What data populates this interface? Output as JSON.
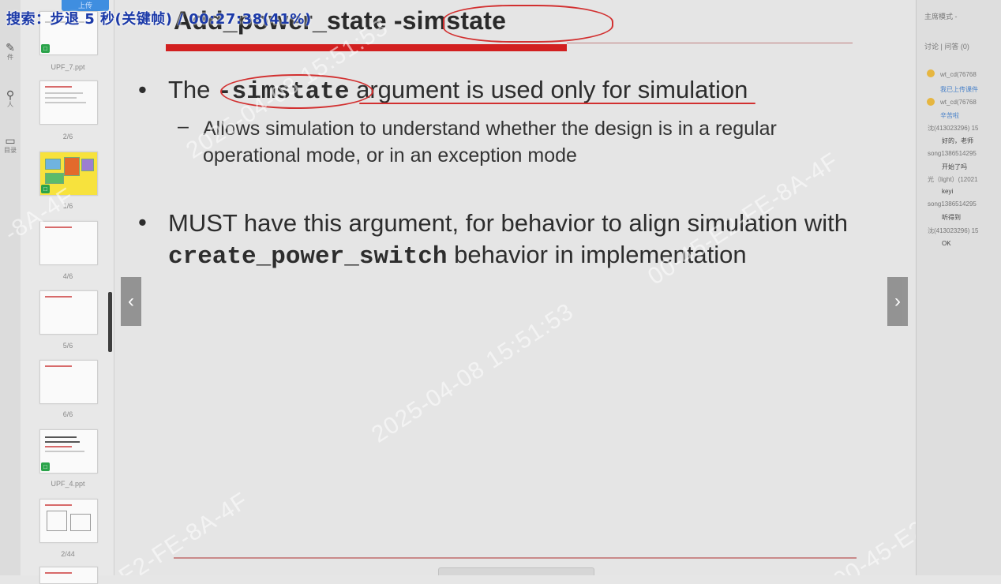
{
  "overlay": {
    "seek_text": "搜索：步退 5 秒(关键帧) / 00:27:38(41%)"
  },
  "toolstrip": {
    "items": [
      {
        "icon": "pencil-icon",
        "label": "件"
      },
      {
        "icon": "pin-icon",
        "label": "人"
      },
      {
        "icon": "doc-icon",
        "label": "目录"
      }
    ]
  },
  "thumbnails": {
    "upload_button": "上传",
    "labels": [
      "UPF_7.ppt",
      "2/6",
      "1/6",
      "4/6",
      "5/6",
      "6/6",
      "UPF_4.ppt",
      "2/44"
    ],
    "badge_symbol": "□"
  },
  "slide": {
    "title_main": "Add_power_state ",
    "title_flag": "-simstate",
    "bullet_glyph": "•",
    "sub_glyph": "–",
    "bullet1_pre": "The ",
    "bullet1_code": "-simstate",
    "bullet1_post": " argument is used only for simulation",
    "sub1": "Allows simulation to understand whether the design is in a regular operational mode, or in an exception mode",
    "bullet2_pre": "MUST have this argument, for behavior to align simulation with ",
    "bullet2_code": "create_power_switch",
    "bullet2_post": " behavior in implementation"
  },
  "nav": {
    "prev": "‹",
    "next": "›"
  },
  "watermarks": [
    "2025-04-08 15:51:53",
    "2025-04-08 15:51:53",
    "00-45-E2-FE-8A-4F",
    "00-45-E2-FE-8A-4F",
    "E2-FE-8A-4F",
    "-8A-4F"
  ],
  "right_panel": {
    "title": "主席模式 -",
    "tabs": "讨论 | 问答 (0)",
    "lines": [
      {
        "kind": "user",
        "text": "wt_cd(76768"
      },
      {
        "kind": "link",
        "text": "我已上传课件"
      },
      {
        "kind": "user",
        "text": "wt_cd(76768"
      },
      {
        "kind": "link",
        "text": "辛苦啦"
      },
      {
        "kind": "user",
        "text": "沈(413023296) 15"
      },
      {
        "kind": "msg",
        "text": "好的，老师"
      },
      {
        "kind": "user",
        "text": "song1386514295"
      },
      {
        "kind": "msg",
        "text": "开始了吗"
      },
      {
        "kind": "user",
        "text": "光（light）(12021"
      },
      {
        "kind": "msg",
        "text": "keyi"
      },
      {
        "kind": "user",
        "text": "song1386514295"
      },
      {
        "kind": "msg",
        "text": "听得到"
      },
      {
        "kind": "user",
        "text": "沈(413023296) 15"
      },
      {
        "kind": "msg",
        "text": "OK"
      }
    ]
  },
  "colors": {
    "accent_red": "#d22020",
    "overlay_blue": "#1c3aa8",
    "upload_blue": "#3f8ee0",
    "badge_green": "#2aa34a"
  }
}
